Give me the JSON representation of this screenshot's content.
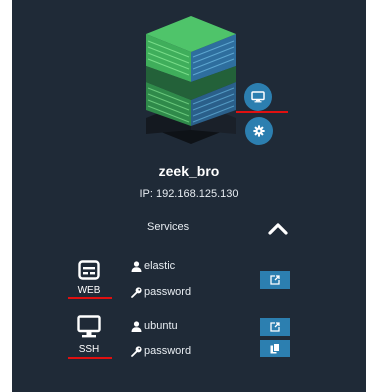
{
  "host": {
    "name": "zeek_bro",
    "ip": "IP: 192.168.125.130"
  },
  "services_section": {
    "label": "Services"
  },
  "services": [
    {
      "name": "WEB",
      "username": "elastic",
      "password": "password"
    },
    {
      "name": "SSH",
      "username": "ubuntu",
      "password": "password"
    }
  ],
  "icons": {
    "server": "server-stack-icon",
    "console": "monitor-icon",
    "settings": "gear-icon",
    "collapse": "chevron-up-icon",
    "web": "hard-drive-icon",
    "ssh": "monitor-icon",
    "user": "user-icon",
    "password": "key-icon",
    "open": "external-link-icon",
    "copy": "copy-icon"
  },
  "colors": {
    "card_background": "#1f2a37",
    "accent_blue": "#2c7fb0",
    "annotation_red": "#e01010",
    "server_green": "#3fae5b"
  }
}
